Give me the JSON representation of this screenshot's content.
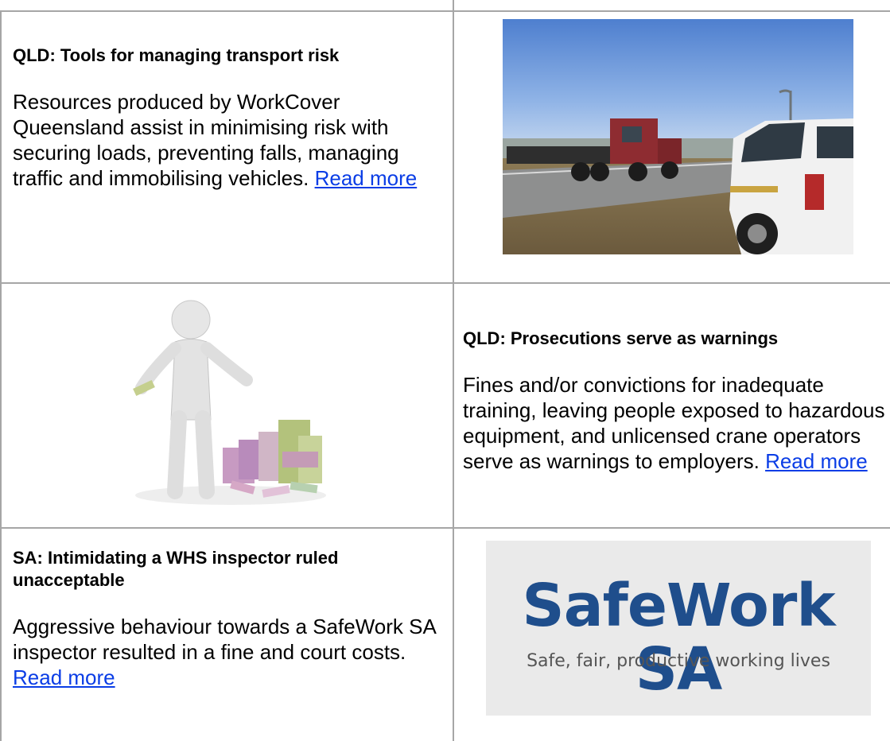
{
  "articles": [
    {
      "heading": "QLD: Tools for managing transport risk",
      "body": "Resources produced by WorkCover Queensland assist in minimising risk with securing loads, preventing falls, managing traffic and immobilising vehicles.",
      "link": "Read more",
      "image": "truck-and-vehicle-on-road-photo"
    },
    {
      "heading": "QLD: Prosecutions serve as warnings",
      "body": "Fines and/or convictions for inadequate training, leaving people exposed to hazardous equipment, and unlicensed crane operators serve as warnings to employers.",
      "link": "Read more",
      "image": "figure-with-money-stacks-illustration"
    },
    {
      "heading": "SA: Intimidating a WHS inspector ruled unacceptable",
      "body": "Aggressive behaviour towards a SafeWork SA inspector resulted in a fine and court costs.",
      "link": "Read more",
      "image": "safework-sa-logo"
    }
  ],
  "logo": {
    "name": "SafeWork SA",
    "tagline": "Safe, fair, productive working lives"
  },
  "colors": {
    "link": "#0a3de6",
    "border": "#a6a6a6",
    "logo_blue": "#1f4e8c"
  }
}
